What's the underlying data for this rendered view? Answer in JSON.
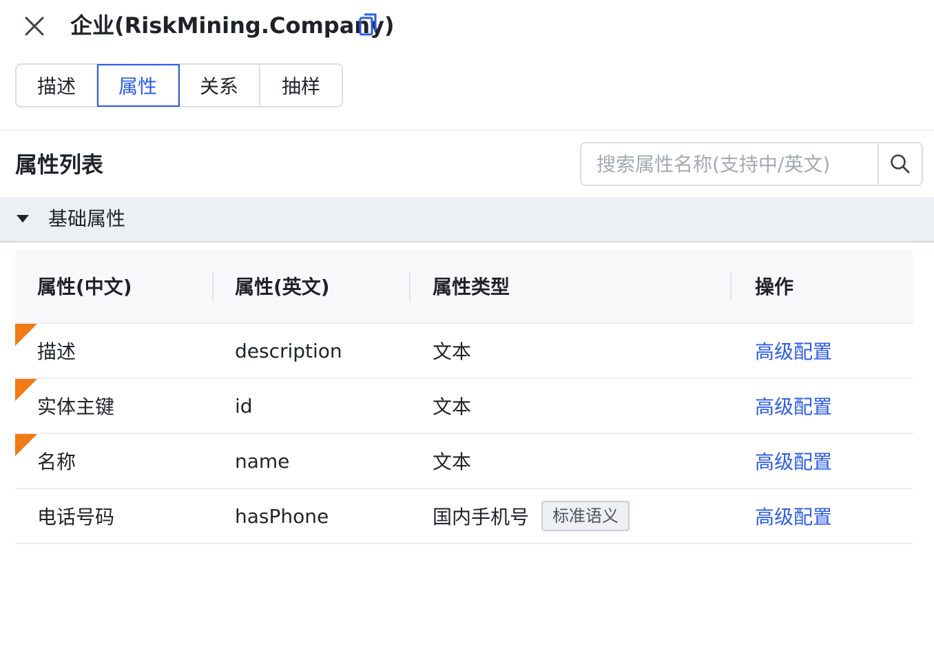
{
  "header": {
    "title": "企业(RiskMining.Company)",
    "close_icon": "close-icon",
    "copy_icon": "copy-icon"
  },
  "tabs": [
    {
      "label": "描述",
      "active": false
    },
    {
      "label": "属性",
      "active": true
    },
    {
      "label": "关系",
      "active": false
    },
    {
      "label": "抽样",
      "active": false
    }
  ],
  "section": {
    "title": "属性列表",
    "search_placeholder": "搜索属性名称(支持中/英文)",
    "search_value": "",
    "search_icon": "search-icon"
  },
  "group": {
    "label": "基础属性",
    "expanded": true,
    "caret_icon": "caret-down-icon"
  },
  "table": {
    "columns": [
      "属性(中文)",
      "属性(英文)",
      "属性类型",
      "操作"
    ],
    "rows": [
      {
        "cn": "描述",
        "en": "description",
        "type": "文本",
        "tag": "",
        "action": "高级配置",
        "builtin": true
      },
      {
        "cn": "实体主键",
        "en": "id",
        "type": "文本",
        "tag": "",
        "action": "高级配置",
        "builtin": true
      },
      {
        "cn": "名称",
        "en": "name",
        "type": "文本",
        "tag": "",
        "action": "高级配置",
        "builtin": true
      },
      {
        "cn": "电话号码",
        "en": "hasPhone",
        "type": "国内手机号",
        "tag": "标准语义",
        "action": "高级配置",
        "builtin": false
      }
    ]
  },
  "colors": {
    "accent": "#2c5ce6",
    "builtin_marker": "#f07a16",
    "group_bg": "#eceff3"
  }
}
